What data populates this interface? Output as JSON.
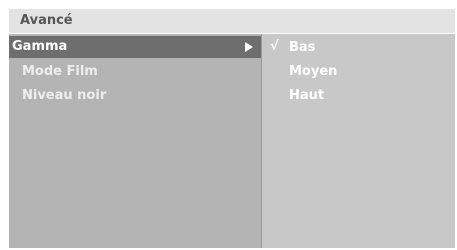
{
  "menu": {
    "title": "Avancé",
    "items": [
      {
        "label": "Gamma",
        "selected": true
      },
      {
        "label": "Mode Film",
        "selected": false
      },
      {
        "label": "Niveau noir",
        "selected": false
      }
    ],
    "submenu_arrow_icon": "arrow-right-icon"
  },
  "submenu": {
    "check_mark": "√",
    "options": [
      {
        "label": "Bas",
        "checked": true
      },
      {
        "label": "Moyen",
        "checked": false
      },
      {
        "label": "Haut",
        "checked": false
      }
    ]
  },
  "colors": {
    "title_bar": "#e3e3e3",
    "left_panel": "#b4b4b4",
    "right_panel": "#c8c8c8",
    "selected_row": "#6e6e6e",
    "text": "#ffffff"
  }
}
